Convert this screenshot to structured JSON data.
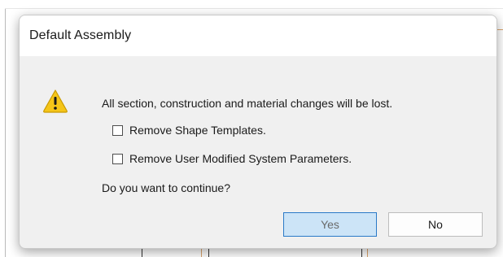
{
  "dialog": {
    "title": "Default Assembly",
    "icon": "warning-icon",
    "message": "All section, construction and material changes will be lost.",
    "options": [
      {
        "label": "Remove Shape Templates.",
        "checked": false
      },
      {
        "label": "Remove User Modified System Parameters.",
        "checked": false
      }
    ],
    "question": "Do you want to continue?",
    "buttons": {
      "yes_label": "Yes",
      "no_label": "No"
    }
  },
  "colors": {
    "dialog_background": "#f0f0f0",
    "titlebar_background": "#ffffff",
    "warning_fill": "#f5c518",
    "default_button_fill": "#cce4f7",
    "default_button_border": "#2a79c7"
  }
}
